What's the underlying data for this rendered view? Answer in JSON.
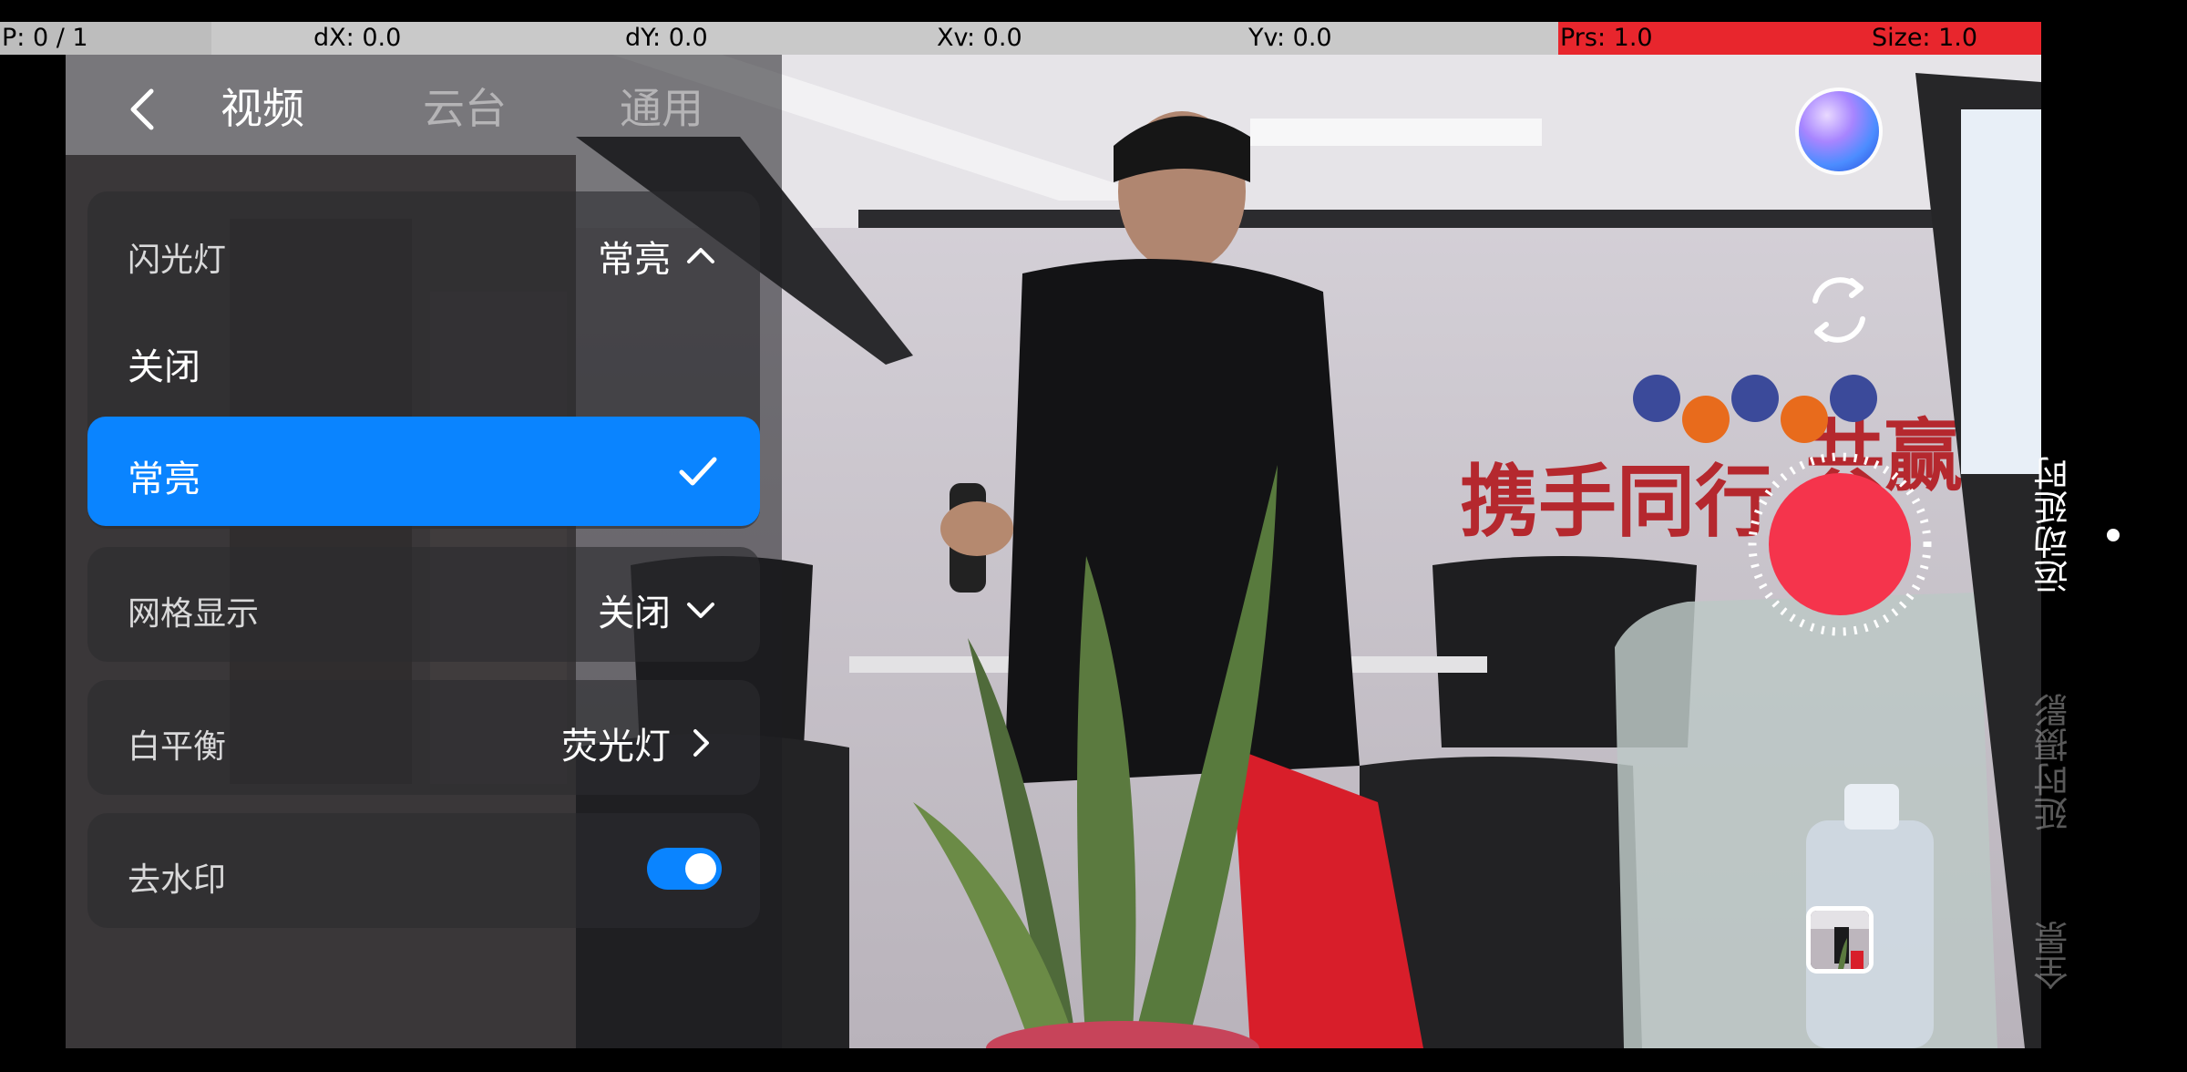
{
  "debug_bar": {
    "pointer": "P: 0 / 1",
    "dx": "dX: 0.0",
    "dy": "dY: 0.0",
    "xv": "Xv: 0.0",
    "yv": "Yv: 0.0",
    "prs": "Prs: 1.0",
    "size": "Size: 1.0",
    "pressure_color": "#e8262d",
    "text_color": "#000000"
  },
  "nav": {
    "back_icon": "chevron-left-icon",
    "tabs": [
      {
        "label": "视频",
        "active": true
      },
      {
        "label": "云台",
        "active": false
      },
      {
        "label": "通用",
        "active": false
      }
    ]
  },
  "settings": {
    "flash": {
      "label": "闪光灯",
      "value": "常亮",
      "icon": "chevron-up-icon"
    },
    "flash_options": [
      {
        "label": "关闭",
        "selected": false
      },
      {
        "label": "常亮",
        "selected": true
      }
    ],
    "grid": {
      "label": "网格显示",
      "value": "关闭",
      "icon": "chevron-down-icon"
    },
    "white_balance": {
      "label": "白平衡",
      "value": "荧光灯",
      "icon": "chevron-right-icon"
    },
    "watermark": {
      "label": "去水印",
      "enabled": true
    }
  },
  "camera": {
    "gallery_icon": "gallery-orb-icon",
    "flip_icon": "camera-flip-icon",
    "shutter_icon": "record-button-icon",
    "thumbnail_icon": "last-capture-thumbnail",
    "shutter_color": "#f5344c",
    "accent_color": "#0a84ff"
  },
  "modes": {
    "active": "运动延时",
    "items": [
      "运动延时",
      "延时摄影",
      "全景"
    ]
  }
}
